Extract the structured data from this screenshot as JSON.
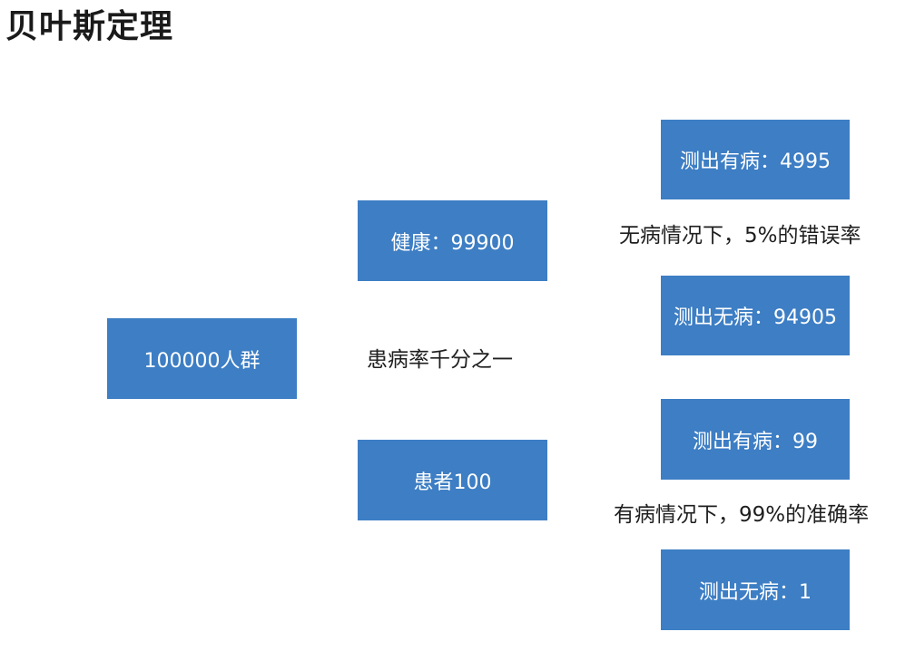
{
  "title": "贝叶斯定理",
  "population": {
    "label": "100000人群"
  },
  "prevalence_note": "患病率千分之一",
  "healthy": {
    "label": "健康：99900",
    "error_note": "无病情况下，5%的错误率",
    "test_positive": "测出有病：4995",
    "test_negative": "测出无病：94905"
  },
  "patient": {
    "label": "患者100",
    "accuracy_note": "有病情况下，99%的准确率",
    "test_positive": "测出有病：99",
    "test_negative": "测出无病：1"
  },
  "colors": {
    "box_fill": "#3d7ec4",
    "box_text": "#ffffff",
    "note_text": "#1f1f1f",
    "title_text": "#1a1a1a"
  }
}
